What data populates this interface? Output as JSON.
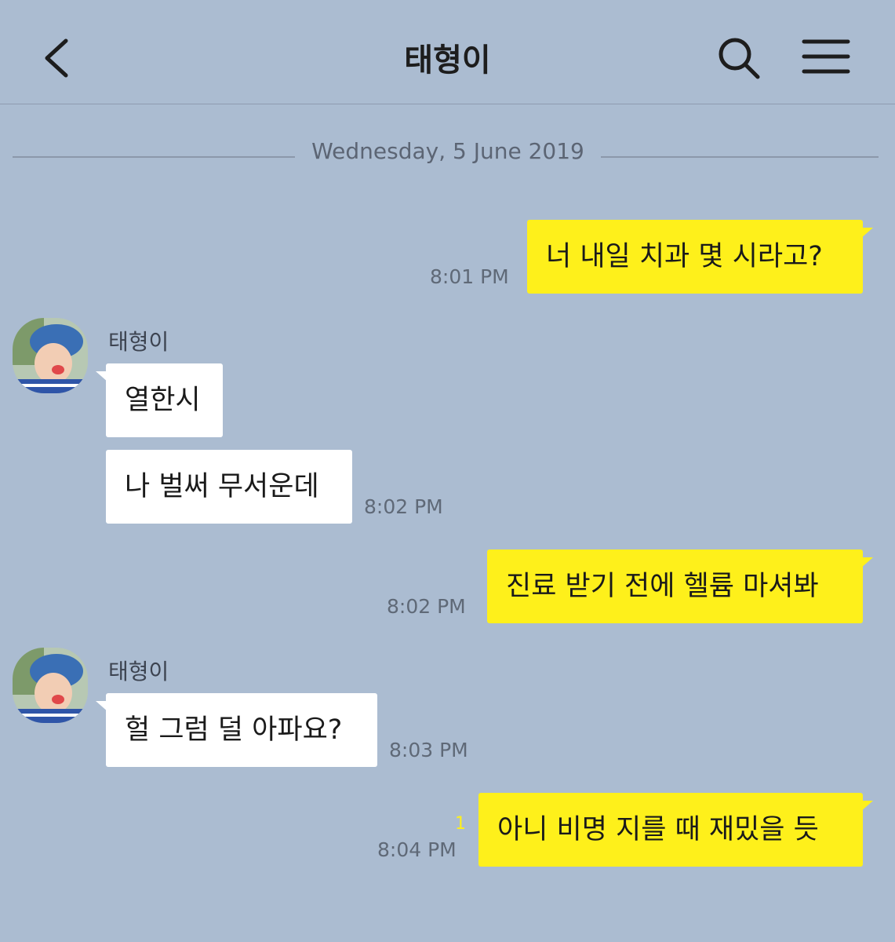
{
  "header": {
    "title": "태형이",
    "back_icon": "chevron-left-icon",
    "search_icon": "search-icon",
    "menu_icon": "hamburger-menu-icon"
  },
  "date_divider": "Wednesday, 5 June 2019",
  "colors": {
    "background": "#abbcd1",
    "my_bubble": "#fef01b",
    "their_bubble": "#ffffff"
  },
  "messages": [
    {
      "sender": "me",
      "text": "너 내일 치과 몇 시라고?",
      "time": "8:01 PM"
    },
    {
      "sender": "태형이",
      "text": "열한시"
    },
    {
      "sender": "태형이",
      "text": "나 벌써 무서운데",
      "time": "8:02 PM"
    },
    {
      "sender": "me",
      "text": "진료 받기 전에 헬륨 마셔봐",
      "time": "8:02 PM"
    },
    {
      "sender": "태형이",
      "text": "헐 그럼 덜 아파요?",
      "time": "8:03 PM"
    },
    {
      "sender": "me",
      "text": "아니 비명 지를 때 재밌을 듯",
      "time": "8:04 PM",
      "unread": "1"
    }
  ],
  "contact": {
    "name": "태형이",
    "avatar_icon": "profile-photo-avatar"
  }
}
